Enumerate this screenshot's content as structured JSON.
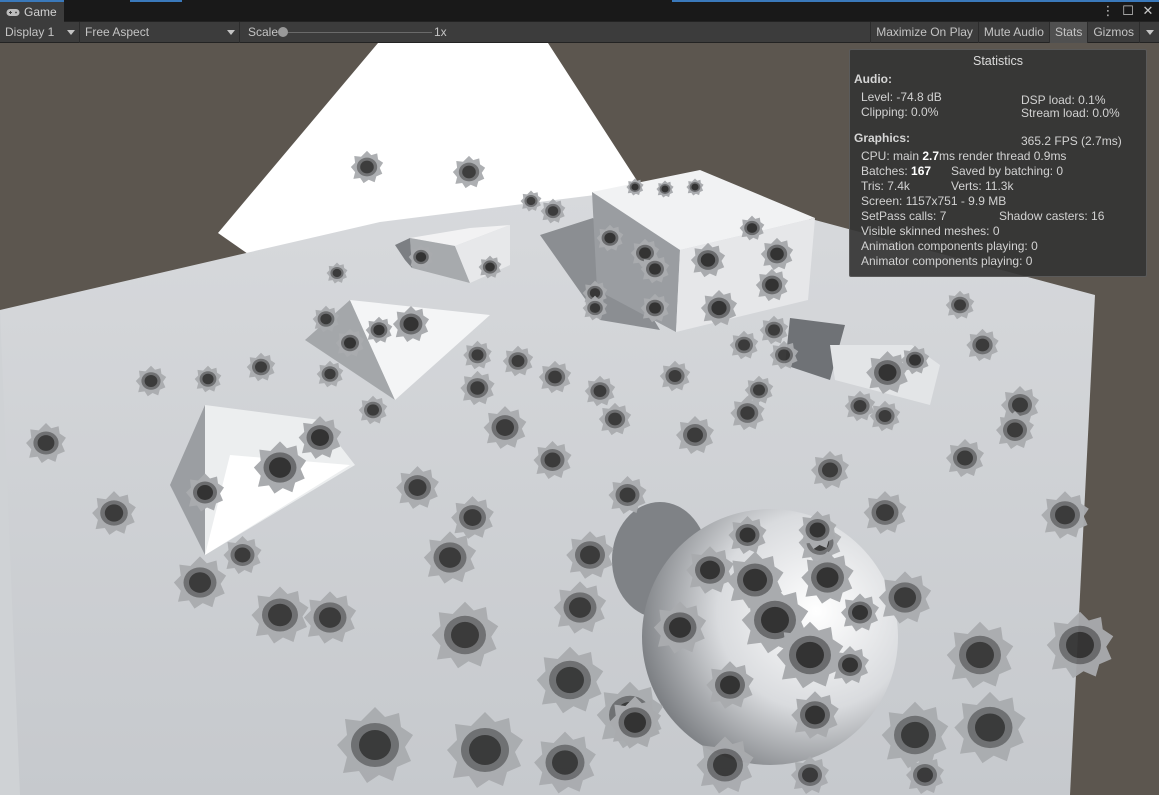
{
  "window": {
    "tab_label": "Game",
    "tab_icon": "gamepad-icon",
    "controls": {
      "menu": "⋮",
      "maximize": "☐",
      "close": "✕"
    }
  },
  "toolbar": {
    "display": "Display 1",
    "aspect": "Free Aspect",
    "scale_label": "Scale",
    "scale_value": "1x",
    "scale_level": 0.0,
    "maximize_on_play": "Maximize On Play",
    "mute_audio": "Mute Audio",
    "stats": "Stats",
    "gizmos": "Gizmos"
  },
  "stats": {
    "title": "Statistics",
    "audio_header": "Audio:",
    "level": "Level: -74.8 dB",
    "dsp_load": "DSP load: 0.1%",
    "clipping": "Clipping: 0.0%",
    "stream_load": "Stream load: 0.0%",
    "graphics_header": "Graphics:",
    "fps": "365.2 FPS (2.7ms)",
    "cpu_prefix": "CPU: main ",
    "cpu_main": "2.7",
    "cpu_suffix": "ms  render thread 0.9ms",
    "batches_prefix": "Batches: ",
    "batches": "167",
    "saved_by_batching": "Saved by batching: 0",
    "tris": "Tris: 7.4k",
    "verts": "Verts: 11.3k",
    "screen": "Screen: 1157x751 - 9.9 MB",
    "setpass": "SetPass calls: 7",
    "shadow_casters": "Shadow casters: 16",
    "skinned": "Visible skinned meshes: 0",
    "animation": "Animation components playing: 0",
    "animator": "Animator components playing: 0"
  },
  "colors": {
    "accent": "#3a79bb",
    "panel": "#3c3c3c",
    "background": "#5c564f",
    "plane": "#c9ccd0"
  }
}
